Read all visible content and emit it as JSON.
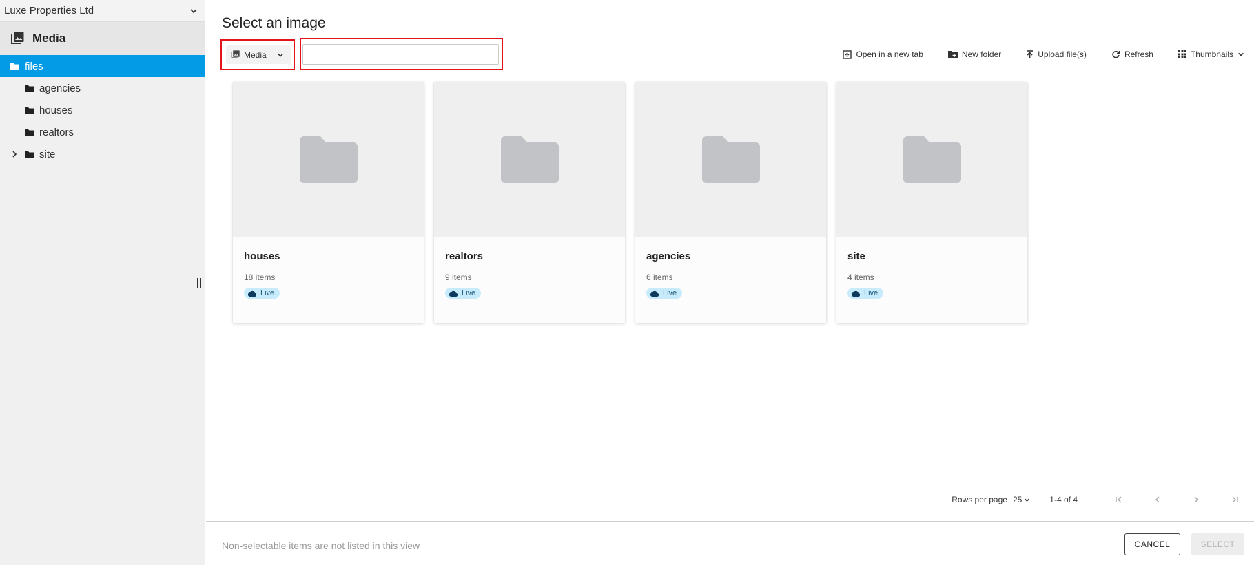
{
  "sidebar": {
    "site_name": "Luxe Properties Ltd",
    "section_title": "Media",
    "tree": {
      "root": "files",
      "children": [
        "agencies",
        "houses",
        "realtors",
        "site"
      ]
    }
  },
  "header": {
    "title": "Select an image"
  },
  "toolbar": {
    "source_select": "Media",
    "search_value": "",
    "actions": {
      "open_new_tab": "Open in a new tab",
      "new_folder": "New folder",
      "upload": "Upload file(s)",
      "refresh": "Refresh",
      "view_mode": "Thumbnails"
    }
  },
  "cards": [
    {
      "name": "houses",
      "count": "18 items",
      "status": "Live"
    },
    {
      "name": "realtors",
      "count": "9 items",
      "status": "Live"
    },
    {
      "name": "agencies",
      "count": "6 items",
      "status": "Live"
    },
    {
      "name": "site",
      "count": "4 items",
      "status": "Live"
    }
  ],
  "pagination": {
    "rows_label": "Rows per page",
    "rows_value": "25",
    "range": "1-4 of 4"
  },
  "footer": {
    "note": "Non-selectable items are not listed in this view",
    "cancel": "CANCEL",
    "select": "SELECT"
  },
  "colors": {
    "accent": "#039be5",
    "highlight_border": "#e3141c",
    "live_badge_bg": "#c8ebfb"
  }
}
